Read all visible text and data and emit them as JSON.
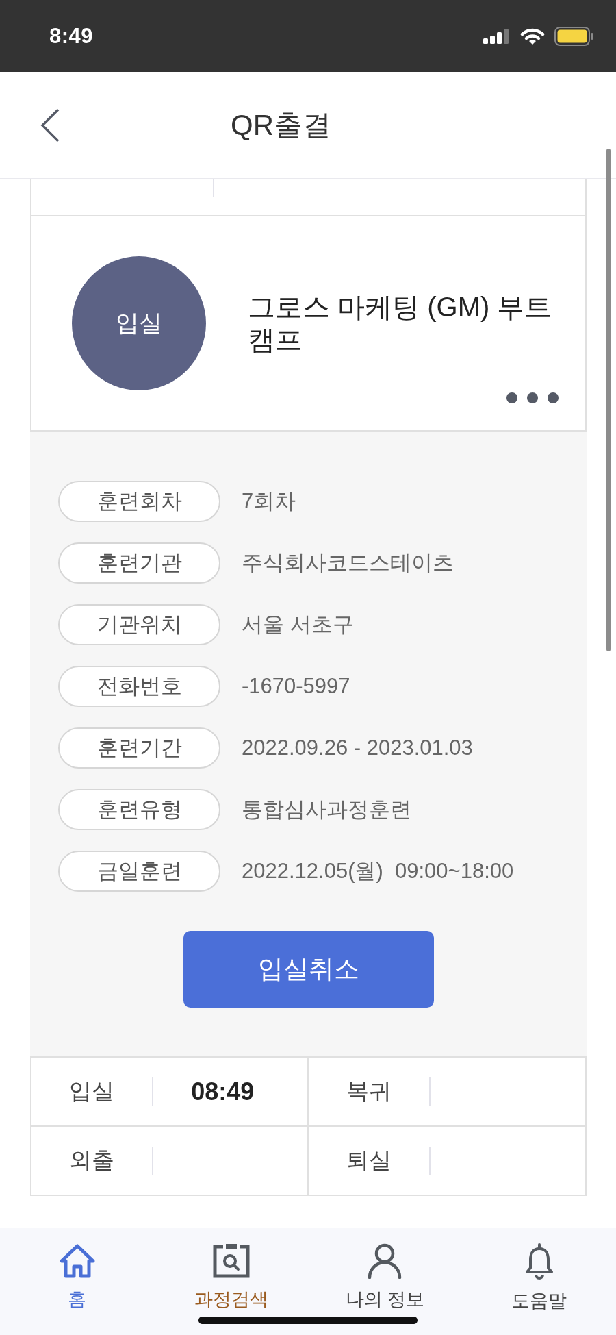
{
  "status_bar": {
    "time": "8:49"
  },
  "header": {
    "title": "QR출결"
  },
  "course": {
    "status": "입실",
    "title": "그로스 마케팅 (GM) 부트캠프"
  },
  "details": [
    {
      "label": "훈련회차",
      "value": "7회차"
    },
    {
      "label": "훈련기관",
      "value": "주식회사코드스테이츠"
    },
    {
      "label": "기관위치",
      "value": "서울 서초구"
    },
    {
      "label": "전화번호",
      "value": "-1670-5997"
    },
    {
      "label": "훈련기간",
      "value": "2022.09.26 - 2023.01.03"
    },
    {
      "label": "훈련유형",
      "value": "통합심사과정훈련"
    },
    {
      "label": "금일훈련",
      "value": "2022.12.05(월)  09:00~18:00"
    }
  ],
  "action_button": {
    "label": "입실취소"
  },
  "attendance": [
    {
      "label": "입실",
      "time": "08:49"
    },
    {
      "label": "복귀"
    },
    {
      "label": "외출"
    },
    {
      "label": "퇴실"
    }
  ],
  "nav": [
    {
      "label": "홈",
      "selected": true,
      "color": "#4a6fd6"
    },
    {
      "label": "과정검색",
      "selected": false,
      "color": "#9a5b1f"
    },
    {
      "label": "나의 정보",
      "selected": false,
      "color": "#444444"
    },
    {
      "label": "도움말",
      "selected": false,
      "color": "#444444"
    }
  ]
}
